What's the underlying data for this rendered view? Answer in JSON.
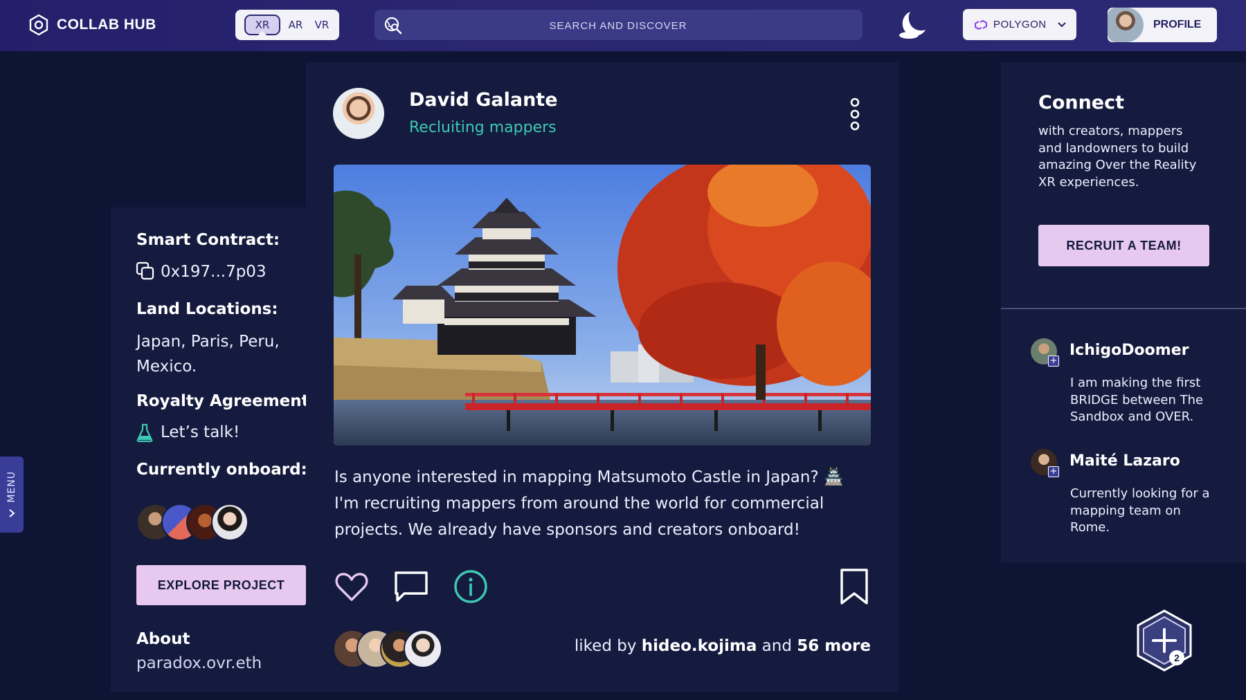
{
  "app": {
    "title": "COLLAB HUB"
  },
  "topbar": {
    "modes": [
      "XR",
      "AR",
      "VR"
    ],
    "active_mode": "XR",
    "search_placeholder": "SEARCH AND DISCOVER",
    "network_label": "POLYGON",
    "profile_label": "PROFILE"
  },
  "side_menu": {
    "label": "MENU"
  },
  "project": {
    "smart_contract_label": "Smart Contract:",
    "smart_contract_value": "0x197...7p03",
    "land_locations_label": "Land Locations:",
    "land_locations_value": "Japan, Paris, Peru, Mexico.",
    "royalty_label": "Royalty Agreements:",
    "royalty_value": "Let’s talk!",
    "onboard_label": "Currently onboard:",
    "explore_button": "EXPLORE PROJECT",
    "about_label": "About",
    "about_value": "paradox.ovr.eth"
  },
  "post": {
    "author": "David Galante",
    "subtitle": "Recluiting mappers",
    "text": "Is anyone interested in mapping Matsumoto Castle in Japan? 🏯 I'm recruiting mappers from around the world for commercial projects. We already have sponsors and creators onboard!",
    "liked_prefix": "liked by",
    "liked_user": "hideo.kojima",
    "liked_and": "and",
    "liked_more": "56 more"
  },
  "connect": {
    "title": "Connect",
    "text": "with creators, mappers and landowners to build amazing Over the Reality XR experiences.",
    "recruit_button": "RECRUIT A TEAM!"
  },
  "suggestions": [
    {
      "name": "IchigoDoomer",
      "text": "I am making the first BRIDGE between The Sandbox and OVER."
    },
    {
      "name": "Maité Lazaro",
      "text": "Currently looking for a mapping team on Rome."
    }
  ],
  "fab": {
    "badge": "2"
  },
  "icons": {
    "logo": "hexagon-logo-icon",
    "search": "search-globe-icon",
    "theme": "moon-icon",
    "network": "polygon-link-icon",
    "more": "more-vertical-icon",
    "like": "heart-icon",
    "comment": "comment-icon",
    "info": "info-icon",
    "bookmark": "bookmark-icon",
    "copy": "copy-icon",
    "royalty": "flask-icon",
    "add": "hex-plus-icon"
  },
  "colors": {
    "accent_teal": "#3ec9b4",
    "button_pink": "#e7c9f0",
    "panel_bg": "#141b3e",
    "page_bg": "#0e1534"
  }
}
